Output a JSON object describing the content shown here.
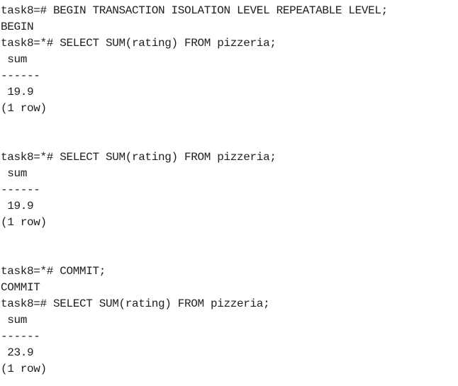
{
  "terminal": {
    "lines": [
      "task8=# BEGIN TRANSACTION ISOLATION LEVEL REPEATABLE LEVEL;",
      "BEGIN",
      "task8=*# SELECT SUM(rating) FROM pizzeria;",
      " sum",
      "------",
      " 19.9",
      "(1 row)",
      "",
      "",
      "task8=*# SELECT SUM(rating) FROM pizzeria;",
      " sum",
      "------",
      " 19.9",
      "(1 row)",
      "",
      "",
      "task8=*# COMMIT;",
      "COMMIT",
      "task8=# SELECT SUM(rating) FROM pizzeria;",
      " sum",
      "------",
      " 23.9",
      "(1 row)"
    ]
  }
}
